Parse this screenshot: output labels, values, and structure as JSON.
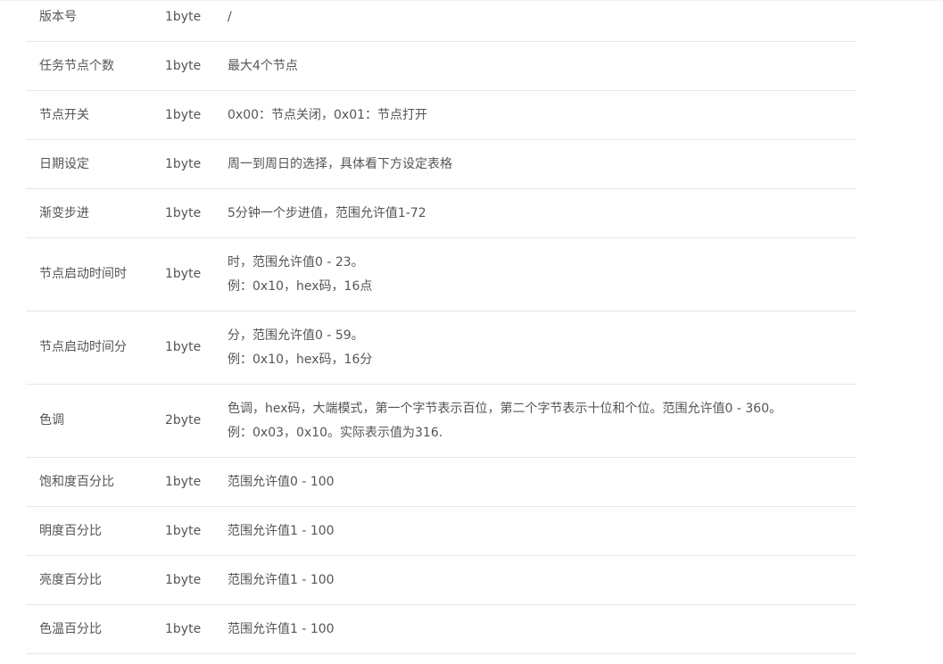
{
  "rows": [
    {
      "name": "版本号",
      "size": "1byte",
      "desc": [
        "/"
      ]
    },
    {
      "name": "任务节点个数",
      "size": "1byte",
      "desc": [
        "最大4个节点"
      ]
    },
    {
      "name": "节点开关",
      "size": "1byte",
      "desc": [
        "0x00：节点关闭，0x01：节点打开"
      ]
    },
    {
      "name": "日期设定",
      "size": "1byte",
      "desc": [
        "周一到周日的选择，具体看下方设定表格"
      ]
    },
    {
      "name": "渐变步进",
      "size": "1byte",
      "desc": [
        "5分钟一个步进值，范围允许值1-72"
      ]
    },
    {
      "name": "节点启动时间时",
      "size": "1byte",
      "desc": [
        "时，范围允许值0 - 23。",
        "例：0x10，hex码，16点"
      ]
    },
    {
      "name": "节点启动时间分",
      "size": "1byte",
      "desc": [
        "分，范围允许值0 - 59。",
        "例：0x10，hex码，16分"
      ]
    },
    {
      "name": "色调",
      "size": "2byte",
      "desc": [
        "色调，hex码，大端模式，第一个字节表示百位，第二个字节表示十位和个位。范围允许值0 - 360。",
        "例：0x03，0x10。实际表示值为316."
      ]
    },
    {
      "name": "饱和度百分比",
      "size": "1byte",
      "desc": [
        "范围允许值0 - 100"
      ]
    },
    {
      "name": "明度百分比",
      "size": "1byte",
      "desc": [
        "范围允许值1 - 100"
      ]
    },
    {
      "name": "亮度百分比",
      "size": "1byte",
      "desc": [
        "范围允许值1 - 100"
      ]
    },
    {
      "name": "色温百分比",
      "size": "1byte",
      "desc": [
        "范围允许值1 - 100"
      ]
    }
  ]
}
